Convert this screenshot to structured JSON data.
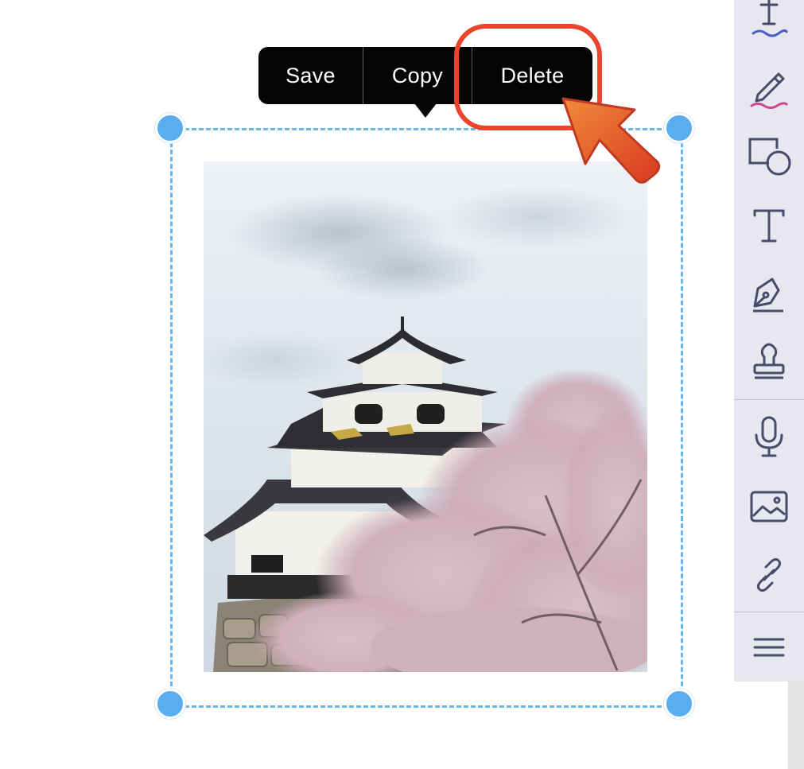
{
  "context_menu": {
    "items": [
      {
        "label": "Save",
        "icon": null
      },
      {
        "label": "Copy",
        "icon": null
      },
      {
        "label": "Delete",
        "icon": null
      }
    ]
  },
  "annotation": {
    "highlight_color": "#e8452c",
    "arrow_color": "#e04a26",
    "target": "Delete"
  },
  "selection": {
    "frame_color": "#6ab4ec",
    "handle_color": "#5aaef0",
    "image_subject": "castle with cherry blossoms"
  },
  "toolbar": {
    "background": "#e7e7f0",
    "icon_color": "#4a4a6a",
    "tools": [
      {
        "name": "text-highlight-tool",
        "icon": "text-underline-icon"
      },
      {
        "name": "pen-tool",
        "icon": "pencil-icon"
      },
      {
        "name": "shapes-tool",
        "icon": "shapes-icon"
      },
      {
        "name": "text-tool",
        "icon": "text-icon"
      },
      {
        "name": "signature-tool",
        "icon": "signature-pen-icon"
      },
      {
        "name": "stamp-tool",
        "icon": "stamp-icon"
      },
      {
        "name": "audio-tool",
        "icon": "microphone-icon"
      },
      {
        "name": "image-tool",
        "icon": "image-icon"
      },
      {
        "name": "link-tool",
        "icon": "link-icon"
      },
      {
        "name": "menu",
        "icon": "hamburger-icon"
      }
    ]
  }
}
